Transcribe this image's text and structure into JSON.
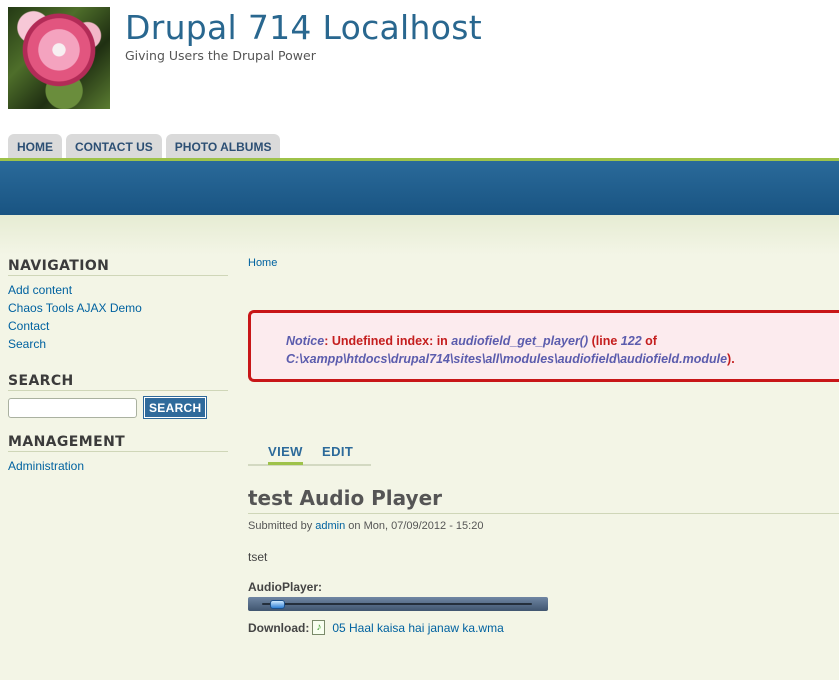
{
  "site": {
    "name": "Drupal 714 Localhost",
    "slogan": "Giving Users the Drupal Power"
  },
  "main_menu": [
    {
      "label": "HOME"
    },
    {
      "label": "CONTACT US"
    },
    {
      "label": "PHOTO ALBUMS"
    }
  ],
  "sidebar": {
    "navigation": {
      "title": "NAVIGATION",
      "items": [
        "Add content",
        "Chaos Tools AJAX Demo",
        "Contact",
        "Search"
      ]
    },
    "search": {
      "title": "SEARCH",
      "value": "",
      "button_label": "SEARCH"
    },
    "management": {
      "title": "MANAGEMENT",
      "items": [
        "Administration"
      ]
    }
  },
  "breadcrumb": "Home",
  "error": {
    "notice": "Notice",
    "sep1": ": ",
    "undefined": "Undefined index: in ",
    "function": "audiofield_get_player()",
    "sep2": " (",
    "line_word": "line ",
    "line_num": "122",
    "of_word": " of",
    "path": "C:\\xampp\\htdocs\\drupal714\\sites\\all\\modules\\audiofield\\audiofield.module",
    "end": ")."
  },
  "node_tabs": [
    "VIEW",
    "EDIT"
  ],
  "node": {
    "title": "test Audio Player",
    "submitted_prefix": "Submitted by ",
    "author": "admin",
    "submitted_suffix": " on Mon, 07/09/2012 - 15:20",
    "body": "tset",
    "audio_label": "AudioPlayer:",
    "player_position": 0.03,
    "download_label": "Download:",
    "file_name": "05 Haal kaisa hai janaw ka.wma"
  },
  "icons": {
    "file": "audio-file-icon"
  }
}
